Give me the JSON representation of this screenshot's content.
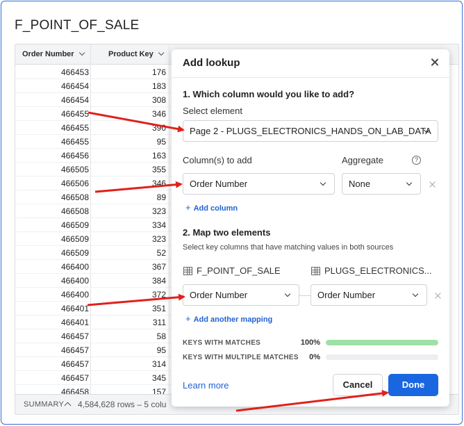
{
  "page_title": "F_POINT_OF_SALE",
  "table": {
    "columns": [
      "Order Number",
      "Product Key"
    ],
    "rows": [
      [
        "466453",
        "176"
      ],
      [
        "466454",
        "183"
      ],
      [
        "466454",
        "308"
      ],
      [
        "466455",
        "346"
      ],
      [
        "466455",
        "390"
      ],
      [
        "466455",
        "95"
      ],
      [
        "466456",
        "163"
      ],
      [
        "466505",
        "355"
      ],
      [
        "466506",
        "346"
      ],
      [
        "466508",
        "89"
      ],
      [
        "466508",
        "323"
      ],
      [
        "466509",
        "334"
      ],
      [
        "466509",
        "323"
      ],
      [
        "466509",
        "52"
      ],
      [
        "466400",
        "367"
      ],
      [
        "466400",
        "384"
      ],
      [
        "466400",
        "372"
      ],
      [
        "466401",
        "351"
      ],
      [
        "466401",
        "311"
      ],
      [
        "466457",
        "58"
      ],
      [
        "466457",
        "95"
      ],
      [
        "466457",
        "314"
      ],
      [
        "466457",
        "345"
      ],
      [
        "466458",
        "157"
      ]
    ],
    "summary_label": "SUMMARY",
    "summary_count": "4,584,628 rows – 5 colu"
  },
  "modal": {
    "title": "Add lookup",
    "step1": "1. Which column would you like to add?",
    "select_element_label": "Select element",
    "select_element_value": "Page 2 - PLUGS_ELECTRONICS_HANDS_ON_LAB_DATA",
    "columns_label": "Column(s) to add",
    "aggregate_label": "Aggregate",
    "help_glyph": "?",
    "column_value": "Order Number",
    "aggregate_value": "None",
    "add_column": "Add column",
    "step2": "2. Map two elements",
    "step2_sub": "Select key columns that have matching values in both sources",
    "source_left": "F_POINT_OF_SALE",
    "source_right": "PLUGS_ELECTRONICS...",
    "map_left_value": "Order Number",
    "map_right_value": "Order Number",
    "add_mapping": "Add another mapping",
    "keys_matches_label": "KEYS WITH MATCHES",
    "keys_matches_pct": "100%",
    "keys_matches_value": 1.0,
    "keys_multi_label": "KEYS WITH MULTIPLE MATCHES",
    "keys_multi_pct": "0%",
    "keys_multi_value": 0.0,
    "learn_more": "Learn more",
    "cancel": "Cancel",
    "done": "Done"
  },
  "colors": {
    "accent": "#1a66e0",
    "match_bar": "#9fe0a5",
    "annotation_arrow": "#e0201b"
  }
}
